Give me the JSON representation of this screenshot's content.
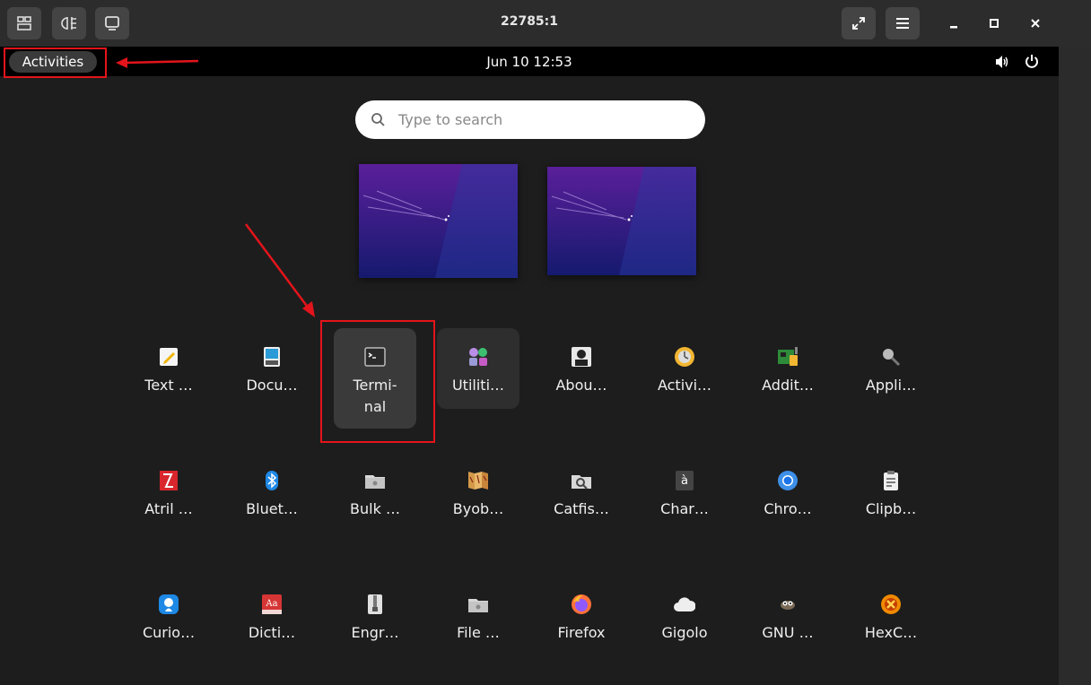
{
  "window": {
    "title": "22785:1",
    "left_buttons": [
      "workspace-overview-icon",
      "clipboard-icon",
      "display-icon"
    ],
    "right_buttons": [
      "fullscreen-icon",
      "menu-icon"
    ],
    "controls": [
      "minimize-icon",
      "maximize-icon",
      "close-icon"
    ]
  },
  "topbar": {
    "activities_label": "Activities",
    "clock": "Jun 10  12:53",
    "status_icons": [
      "volume-icon",
      "power-icon"
    ]
  },
  "search": {
    "placeholder": "Type to search"
  },
  "workspaces": [
    "workspace-1",
    "workspace-2"
  ],
  "apps": [
    {
      "label": "Text …",
      "icon": "text-editor-icon"
    },
    {
      "label": "Docu…",
      "icon": "document-viewer-icon"
    },
    {
      "label": "Termi-",
      "label2": "nal",
      "icon": "terminal-icon",
      "highlighted": true
    },
    {
      "label": "Utiliti…",
      "icon": "utilities-folder-icon"
    },
    {
      "label": "Abou…",
      "icon": "about-icon"
    },
    {
      "label": "Activi…",
      "icon": "activity-log-icon"
    },
    {
      "label": "Addit…",
      "icon": "additional-drivers-icon"
    },
    {
      "label": "Appli…",
      "icon": "app-finder-icon"
    },
    {
      "label": "Atril …",
      "icon": "atril-icon"
    },
    {
      "label": "Bluet…",
      "icon": "bluetooth-icon"
    },
    {
      "label": "Bulk …",
      "icon": "bulk-rename-icon"
    },
    {
      "label": "Byob…",
      "icon": "byobu-icon"
    },
    {
      "label": "Catfis…",
      "icon": "catfish-icon"
    },
    {
      "label": "Char…",
      "icon": "character-map-icon"
    },
    {
      "label": "Chro…",
      "icon": "chromium-icon"
    },
    {
      "label": "Clipb…",
      "icon": "clipboard-manager-icon"
    },
    {
      "label": "Curio…",
      "icon": "curio-icon"
    },
    {
      "label": "Dicti…",
      "icon": "dictionary-icon"
    },
    {
      "label": "Engr…",
      "icon": "engrampa-icon"
    },
    {
      "label": "File …",
      "icon": "file-manager-icon"
    },
    {
      "label": "Firefox",
      "icon": "firefox-icon"
    },
    {
      "label": "Gigolo",
      "icon": "gigolo-icon"
    },
    {
      "label": "GNU …",
      "icon": "gimp-icon"
    },
    {
      "label": "HexC…",
      "icon": "hexchat-icon"
    }
  ],
  "colors": {
    "annotation": "#e3141b",
    "wallpaper_top": "#5a1f9a",
    "wallpaper_bottom": "#151a6e"
  }
}
